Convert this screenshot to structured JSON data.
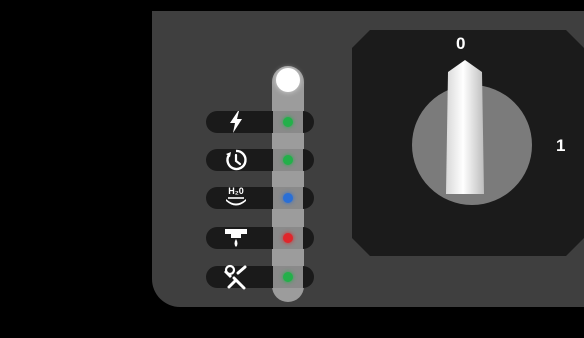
{
  "panel": {
    "colors": {
      "background": "#000000",
      "panel": "#3f3f3f",
      "pill": "#1a1a1a",
      "strip": "#9c9c9c"
    }
  },
  "indicators": [
    {
      "icon": "lightning-icon",
      "led_color": "#23b04a",
      "led_state": "green"
    },
    {
      "icon": "timer-icon",
      "led_color": "#23b04a",
      "led_state": "green"
    },
    {
      "icon": "water-icon",
      "label": "H₂0",
      "led_color": "#2a6fd6",
      "led_state": "blue"
    },
    {
      "icon": "shower-drip-icon",
      "led_color": "#e0262b",
      "led_state": "red"
    },
    {
      "icon": "maintenance-tools-icon",
      "led_color": "#23b04a",
      "led_state": "green"
    }
  ],
  "top_lamp": {
    "state": "on",
    "color": "#ffffff"
  },
  "selector_switch": {
    "position_labels": [
      "0",
      "1"
    ],
    "current_position": "0"
  }
}
